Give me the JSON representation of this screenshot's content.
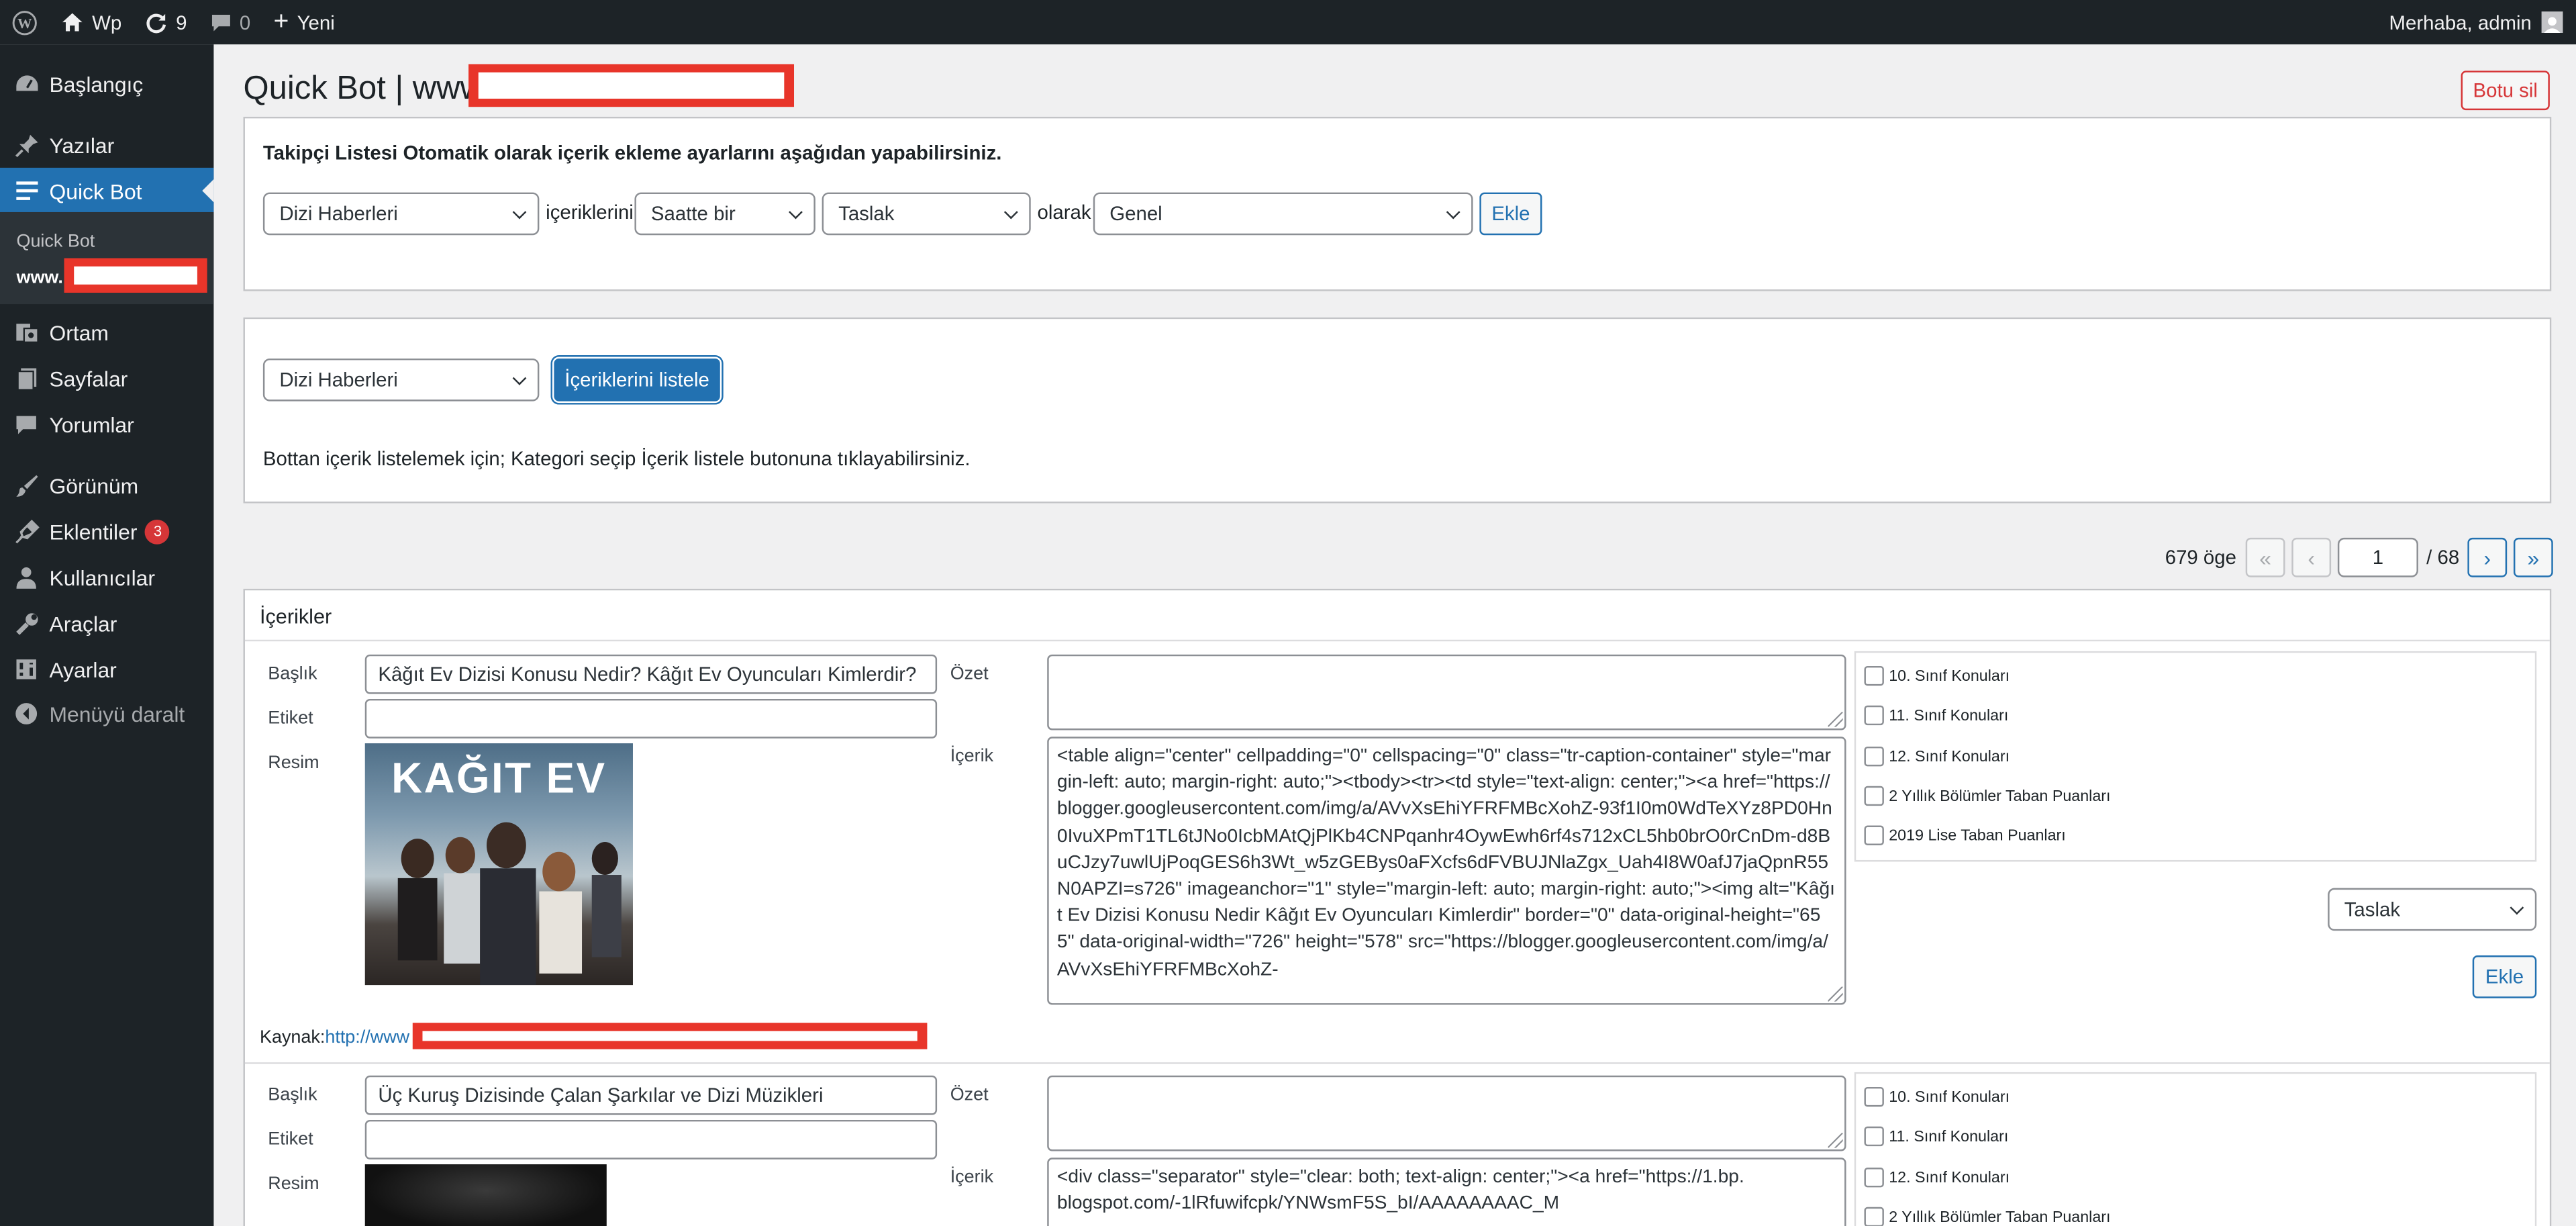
{
  "adminbar": {
    "site_name": "Wp",
    "updates_count": "9",
    "comments_count": "0",
    "new_label": "Yeni",
    "greeting": "Merhaba, admin"
  },
  "sidebar": {
    "items": [
      {
        "label": "Başlangıç",
        "icon": "dashboard-icon"
      },
      {
        "label": "Yazılar",
        "icon": "pin-icon"
      },
      {
        "label": "Quick Bot",
        "icon": "list-icon"
      },
      {
        "label": "Ortam",
        "icon": "media-icon"
      },
      {
        "label": "Sayfalar",
        "icon": "pages-icon"
      },
      {
        "label": "Yorumlar",
        "icon": "comment-icon"
      },
      {
        "label": "Görünüm",
        "icon": "brush-icon"
      },
      {
        "label": "Eklentiler",
        "icon": "plugin-icon",
        "badge": "3"
      },
      {
        "label": "Kullanıcılar",
        "icon": "user-icon"
      },
      {
        "label": "Araçlar",
        "icon": "wrench-icon"
      },
      {
        "label": "Ayarlar",
        "icon": "settings-icon"
      },
      {
        "label": "Menüyü daralt",
        "icon": "collapse-icon"
      }
    ],
    "submenu": {
      "item1": "Quick Bot",
      "item2": "www."
    }
  },
  "page": {
    "title": "Quick Bot | www.",
    "delete_button": "Botu sil"
  },
  "follower": {
    "heading": "Takipçi Listesi",
    "subheading": "Otomatik olarak içerik ekleme ayarlarını aşağıdan yapabilirsiniz.",
    "category_select": "Dizi Haberleri",
    "contents_word": "içeriklerini",
    "frequency_select": "Saatte bir",
    "status_select": "Taslak",
    "as_word": "olarak",
    "target_select": "Genel",
    "add_button": "Ekle"
  },
  "listing": {
    "category_select": "Dizi Haberleri",
    "list_button": "İçeriklerini listele",
    "help_text": "Bottan içerik listelemek için; Kategori seçip İçerik listele butonuna tıklayabilirsiniz."
  },
  "pagination": {
    "item_count": "679 öge",
    "first": "«",
    "prev": "‹",
    "current_page": "1",
    "total_pages": "/ 68",
    "next": "›",
    "last": "»"
  },
  "contents": {
    "heading": "İçerikler",
    "labels": {
      "title": "Başlık",
      "tag": "Etiket",
      "image": "Resim",
      "summary": "Özet",
      "content": "İçerik",
      "source": "Kaynak:"
    },
    "items": [
      {
        "title": "Kâğıt Ev Dizisi Konusu Nedir? Kâğıt Ev Oyuncuları Kimlerdir?",
        "tag": "",
        "summary": "",
        "image_text": "KAĞIT EV",
        "content": "<table align=\"center\" cellpadding=\"0\" cellspacing=\"0\" class=\"tr-caption-container\" style=\"margin-left: auto; margin-right: auto;\"><tbody><tr><td style=\"text-align: center;\"><a href=\"https://blogger.googleusercontent.com/img/a/AVvXsEhiYFRFMBcXohZ-93f1I0m0WdTeXYz8PD0Hn0IvuXPmT1TL6tJNo0IcbMAtQjPlKb4CNPqanhr4OywEwh6rf4s712xCL5hb0brO0rCnDm-d8BuCJzy7uwlUjPoqGES6h3Wt_w5zGEBys0aFXcfs6dFVBUJNlaZgx_Uah4I8W0afJ7jaQpnR55N0APZI=s726\" imageanchor=\"1\" style=\"margin-left: auto; margin-right: auto;\"><img alt=\"Kâğıt Ev Dizisi Konusu Nedir Kâğıt Ev Oyuncuları Kimlerdir\" border=\"0\" data-original-height=\"655\" data-original-width=\"726\" height=\"578\" src=\"https://blogger.googleusercontent.com/img/a/AVvXsEhiYFRFMBcXohZ-",
        "source_prefix": "http://www",
        "categories": [
          "10. Sınıf Konuları",
          "11. Sınıf Konuları",
          "12. Sınıf Konuları",
          "2 Yıllık Bölümler Taban Puanları",
          "2019 Lise Taban Puanları"
        ],
        "status_select": "Taslak",
        "add_button": "Ekle"
      },
      {
        "title": "Üç Kuruş Dizisinde Çalan Şarkılar ve Dizi Müzikleri",
        "tag": "",
        "summary": "",
        "content": "<div class=\"separator\" style=\"clear: both; text-align: center;\"><a href=\"https://1.bp.blogspot.com/-1lRfuwifcpk/YNWsmF5S_bI/AAAAAAAAC_M",
        "categories": [
          "10. Sınıf Konuları",
          "11. Sınıf Konuları",
          "12. Sınıf Konuları",
          "2 Yıllık Bölümler Taban Puanları"
        ]
      }
    ]
  },
  "colors": {
    "admin_dark": "#1d2327",
    "accent": "#2271b1",
    "danger": "#d63638",
    "redaction": "#e8352a"
  }
}
